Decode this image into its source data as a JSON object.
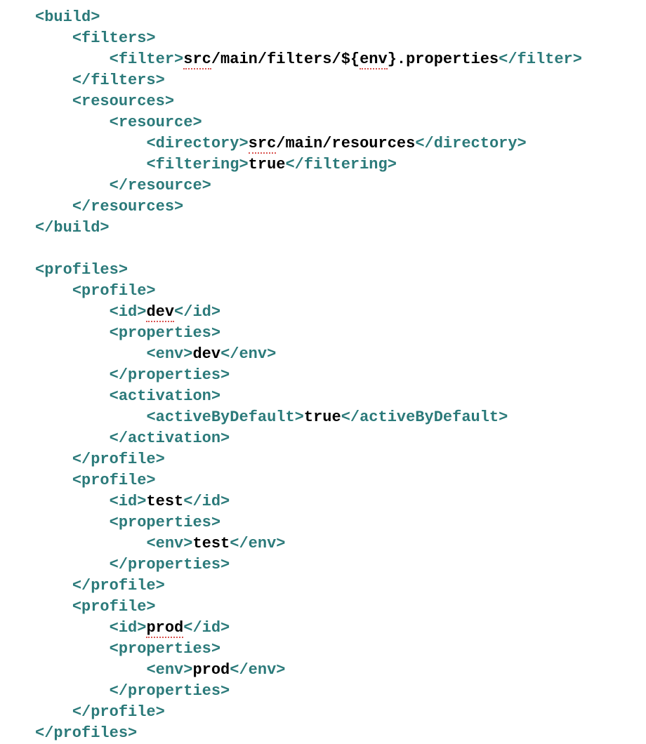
{
  "t": {
    "build_o": "<build>",
    "build_c": "</build>",
    "filters_o": "<filters>",
    "filters_c": "</filters>",
    "filter_o": "<filter>",
    "filter_c": "</filter>",
    "resources_o": "<resources>",
    "resources_c": "</resources>",
    "resource_o": "<resource>",
    "resource_c": "</resource>",
    "directory_o": "<directory>",
    "directory_c": "</directory>",
    "filtering_o": "<filtering>",
    "filtering_c": "</filtering>",
    "profiles_o": "<profiles>",
    "profiles_c": "</profiles>",
    "profile_o": "<profile>",
    "profile_c": "</profile>",
    "id_o": "<id>",
    "id_c": "</id>",
    "properties_o": "<properties>",
    "properties_c": "</properties>",
    "env_o": "<env>",
    "env_c": "</env>",
    "activation_o": "<activation>",
    "activation_c": "</activation>",
    "activeByDefault_o": "<activeByDefault>",
    "activeByDefault_c": "</activeByDefault>"
  },
  "v": {
    "filter_p1": "src",
    "filter_p2": "/main/filters/${",
    "filter_p3": "env",
    "filter_p4": "}.properties",
    "directory_p1": "src",
    "directory_p2": "/main/resources",
    "filtering_val": "true",
    "id_dev": "dev",
    "env_dev": "dev",
    "activeByDefault_val": "true",
    "id_test": "test",
    "env_test": "test",
    "id_prod": "prod",
    "env_prod": "prod"
  }
}
